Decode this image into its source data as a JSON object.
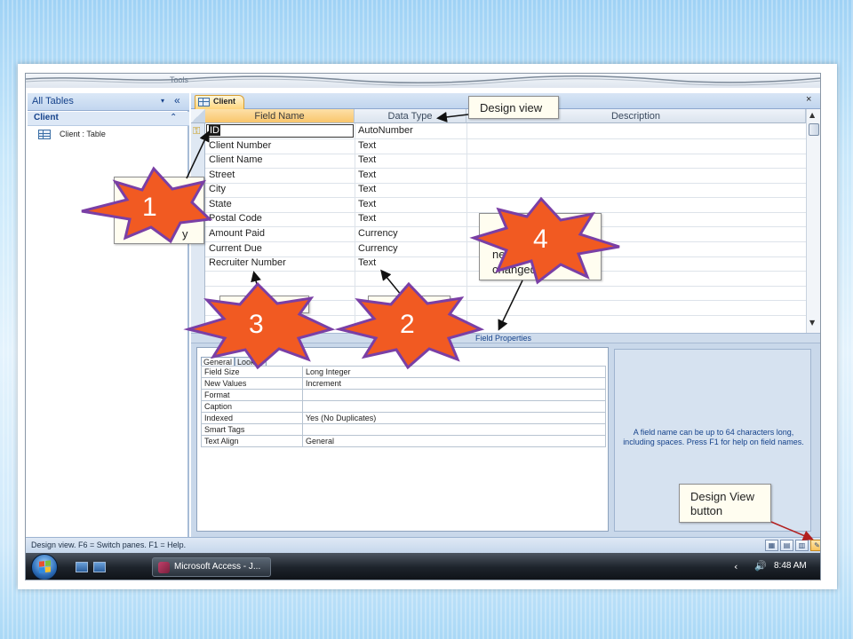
{
  "window": {
    "ribbon_hint": "Tools"
  },
  "nav_pane": {
    "title": "All Tables",
    "dropdown_glyph": "▾",
    "collapse_glyph": "«",
    "group": {
      "title": "Client",
      "toggle_glyph": "»"
    },
    "items": [
      {
        "label": "Client : Table",
        "icon": "table-icon"
      }
    ]
  },
  "document_tab": {
    "label": "Client",
    "close_glyph": "×"
  },
  "design_grid": {
    "columns": [
      "Field Name",
      "Data Type",
      "Description"
    ],
    "rows": [
      {
        "field": "ID",
        "type": "AutoNumber",
        "primary_key": true
      },
      {
        "field": "Client Number",
        "type": "Text"
      },
      {
        "field": "Client Name",
        "type": "Text"
      },
      {
        "field": "Street",
        "type": "Text"
      },
      {
        "field": "City",
        "type": "Text"
      },
      {
        "field": "State",
        "type": "Text"
      },
      {
        "field": "Postal Code",
        "type": "Text"
      },
      {
        "field": "Amount Paid",
        "type": "Currency"
      },
      {
        "field": "Current Due",
        "type": "Currency"
      },
      {
        "field": "Recruiter Number",
        "type": "Text"
      }
    ]
  },
  "field_properties": {
    "label": "Field Properties",
    "tabs": [
      "General",
      "Lookup"
    ],
    "properties": [
      {
        "key": "Field Size",
        "value": "Long Integer"
      },
      {
        "key": "New Values",
        "value": "Increment"
      },
      {
        "key": "Format",
        "value": ""
      },
      {
        "key": "Caption",
        "value": ""
      },
      {
        "key": "Indexed",
        "value": "Yes (No Duplicates)"
      },
      {
        "key": "Smart Tags",
        "value": ""
      },
      {
        "key": "Text Align",
        "value": "General"
      }
    ],
    "help_text": "A field name can be up to 64 characters long, including spaces.  Press F1 for help on field names."
  },
  "status_bar": {
    "text": "Design view.  F6 = Switch panes.  F1 = Help."
  },
  "taskbar": {
    "task_label": "Microsoft Access - J...",
    "tray_arrow": "‹",
    "speaker_glyph": "🔊",
    "clock": "8:48 AM"
  },
  "callouts": {
    "design_view": "Design view",
    "design_view_button": "Design View button",
    "partial_4": "changed)",
    "partial_4b": "ne",
    "partial_1": "y"
  },
  "bursts": [
    "1",
    "2",
    "3",
    "4"
  ],
  "colors": {
    "burst_fill": "#f15a22",
    "burst_stroke": "#7a3fa5",
    "selected_tab": "#f9c66c",
    "access_blue": "#15428b"
  }
}
